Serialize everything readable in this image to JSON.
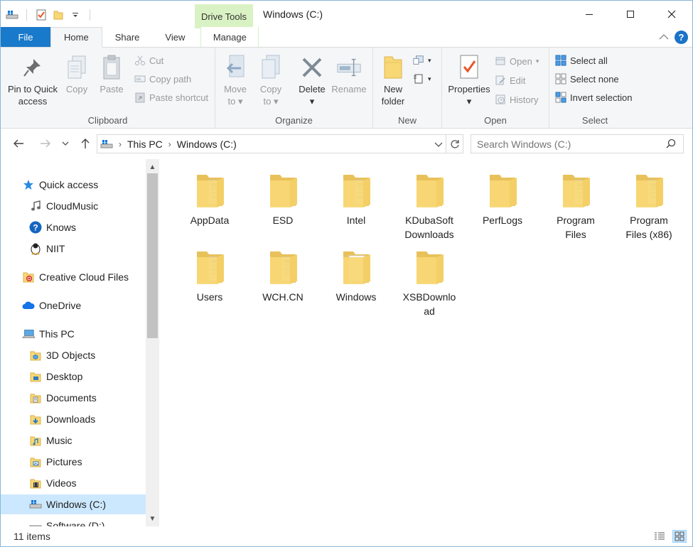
{
  "window": {
    "title": "Windows (C:)",
    "context_tab": "Drive Tools"
  },
  "tabs": [
    {
      "label": "File"
    },
    {
      "label": "Home"
    },
    {
      "label": "Share"
    },
    {
      "label": "View"
    },
    {
      "label": "Manage"
    }
  ],
  "ribbon": {
    "clipboard": {
      "label": "Clipboard",
      "pin_line1": "Pin to Quick",
      "pin_line2": "access",
      "copy": "Copy",
      "paste": "Paste",
      "cut": "Cut",
      "copy_path": "Copy path",
      "paste_shortcut": "Paste shortcut"
    },
    "organize": {
      "label": "Organize",
      "move_line1": "Move",
      "move_line2": "to",
      "copy_line1": "Copy",
      "copy_line2": "to",
      "delete": "Delete",
      "rename": "Rename"
    },
    "new": {
      "label": "New",
      "folder_line1": "New",
      "folder_line2": "folder"
    },
    "open": {
      "label": "Open",
      "properties": "Properties",
      "open": "Open",
      "edit": "Edit",
      "history": "History"
    },
    "select": {
      "label": "Select",
      "all": "Select all",
      "none": "Select none",
      "invert": "Invert selection"
    }
  },
  "address": {
    "root": "This PC",
    "current": "Windows (C:)"
  },
  "search": {
    "placeholder": "Search Windows (C:)"
  },
  "sidebar": {
    "items": [
      {
        "label": "Quick access",
        "icon": "star-icon"
      },
      {
        "label": "CloudMusic",
        "icon": "music-icon"
      },
      {
        "label": "Knows",
        "icon": "help-circle-icon"
      },
      {
        "label": "NIIT",
        "icon": "penguin-icon"
      },
      {
        "label": "Creative Cloud Files",
        "icon": "creative-cloud-icon"
      },
      {
        "label": "OneDrive",
        "icon": "cloud-icon"
      },
      {
        "label": "This PC",
        "icon": "computer-icon"
      },
      {
        "label": "3D Objects",
        "icon": "cube-folder-icon"
      },
      {
        "label": "Desktop",
        "icon": "desktop-folder-icon"
      },
      {
        "label": "Documents",
        "icon": "documents-folder-icon"
      },
      {
        "label": "Downloads",
        "icon": "downloads-folder-icon"
      },
      {
        "label": "Music",
        "icon": "music-folder-icon"
      },
      {
        "label": "Pictures",
        "icon": "pictures-folder-icon"
      },
      {
        "label": "Videos",
        "icon": "videos-folder-icon"
      },
      {
        "label": "Windows (C:)",
        "icon": "drive-icon"
      },
      {
        "label": "Software (D:)",
        "icon": "drive-icon"
      }
    ]
  },
  "files": [
    {
      "line1": "AppData",
      "line2": ""
    },
    {
      "line1": "ESD",
      "line2": ""
    },
    {
      "line1": "Intel",
      "line2": ""
    },
    {
      "line1": "KDubaSoft",
      "line2": "Downloads"
    },
    {
      "line1": "PerfLogs",
      "line2": ""
    },
    {
      "line1": "Program",
      "line2": "Files"
    },
    {
      "line1": "Program",
      "line2": "Files (x86)"
    },
    {
      "line1": "Users",
      "line2": ""
    },
    {
      "line1": "WCH.CN",
      "line2": ""
    },
    {
      "line1": "Windows",
      "line2": ""
    },
    {
      "line1": "XSBDownlo",
      "line2": "ad"
    }
  ],
  "status": {
    "item_count": "11 items"
  },
  "colors": {
    "file_tab": "#1979ca",
    "drive_tools": "#d9f2c3",
    "selection": "#cce8ff",
    "folder": "#f8d775"
  }
}
